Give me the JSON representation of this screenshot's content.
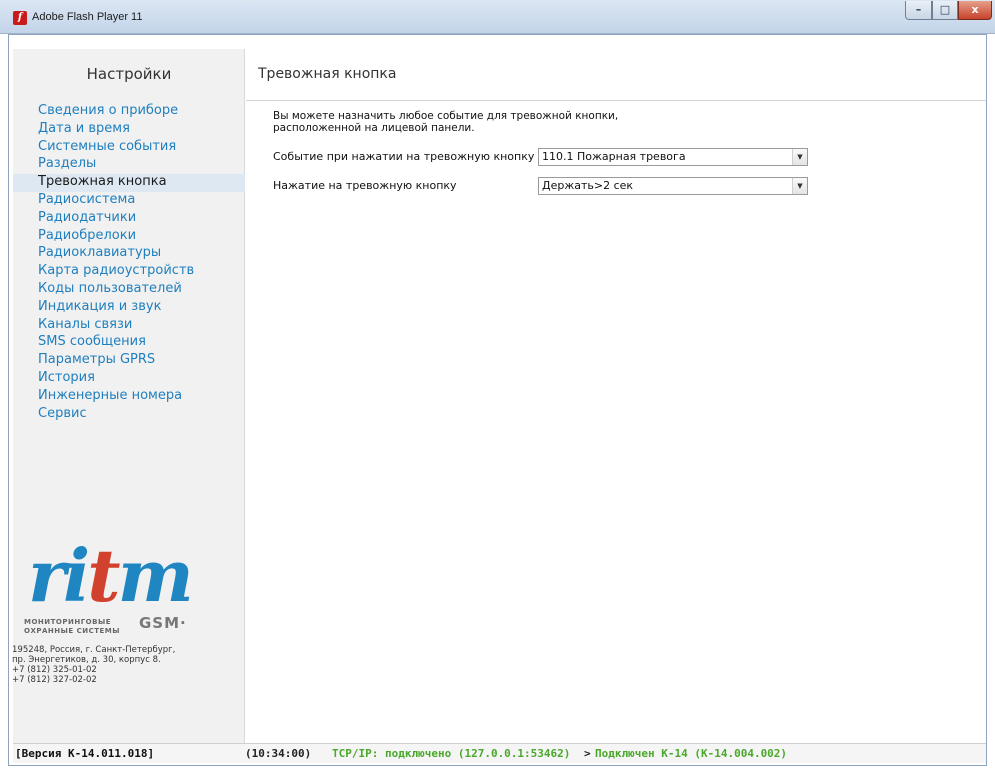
{
  "window": {
    "title": "Adobe Flash Player 11",
    "min_label": "–",
    "max_label": "□",
    "close_label": "x"
  },
  "sidebar": {
    "title": "Настройки",
    "items": [
      {
        "label": "Сведения о приборе"
      },
      {
        "label": "Дата и время"
      },
      {
        "label": "Системные события"
      },
      {
        "label": "Разделы"
      },
      {
        "label": "Тревожная кнопка",
        "active": true
      },
      {
        "label": "Радиосистема"
      },
      {
        "label": "Радиодатчики"
      },
      {
        "label": "Радиобрелоки"
      },
      {
        "label": "Радиоклавиатуры"
      },
      {
        "label": "Карта радиоустройств"
      },
      {
        "label": "Коды пользователей"
      },
      {
        "label": "Индикация и звук"
      },
      {
        "label": "Каналы связи"
      },
      {
        "label": "SMS сообщения"
      },
      {
        "label": "Параметры GPRS"
      },
      {
        "label": "История"
      },
      {
        "label": "Инженерные номера"
      },
      {
        "label": "Сервис"
      }
    ]
  },
  "logo": {
    "ri": "ri",
    "t": "t",
    "m": "m",
    "subtitle_line1": "МОНИТОРИНГОВЫЕ",
    "subtitle_line2": "ОХРАННЫЕ СИСТЕМЫ",
    "gsm": "GSM·"
  },
  "address": {
    "line1": "195248, Россия, г. Санкт-Петербург,",
    "line2": "пр. Энергетиков, д. 30, корпус 8.",
    "line3": "+7 (812) 325-01-02",
    "line4": "+7 (812) 327-02-02"
  },
  "main": {
    "title": "Тревожная кнопка",
    "description_line1": "Вы можете назначить любое событие для тревожной кнопки,",
    "description_line2": "расположенной на лицевой панели.",
    "event_label": "Событие при нажатии на тревожную кнопку",
    "event_value": "110.1 Пожарная тревога",
    "press_label": "Нажатие на тревожную кнопку",
    "press_value": "Держать>2 сек",
    "arrow": "▼"
  },
  "status": {
    "version": "[Версия К-14.011.018]",
    "time": "(10:34:00)",
    "tcp": "TCP/IP: подключено (127.0.0.1:53462)",
    "arrow": ">",
    "device": "Подключен К-14 (К-14.004.002)"
  },
  "colors": {
    "link": "#1f7fbf",
    "active_bg": "#dde8f3",
    "status_green": "#4aa82a",
    "logo_blue": "#1f86c2",
    "logo_red": "#d2412d"
  }
}
